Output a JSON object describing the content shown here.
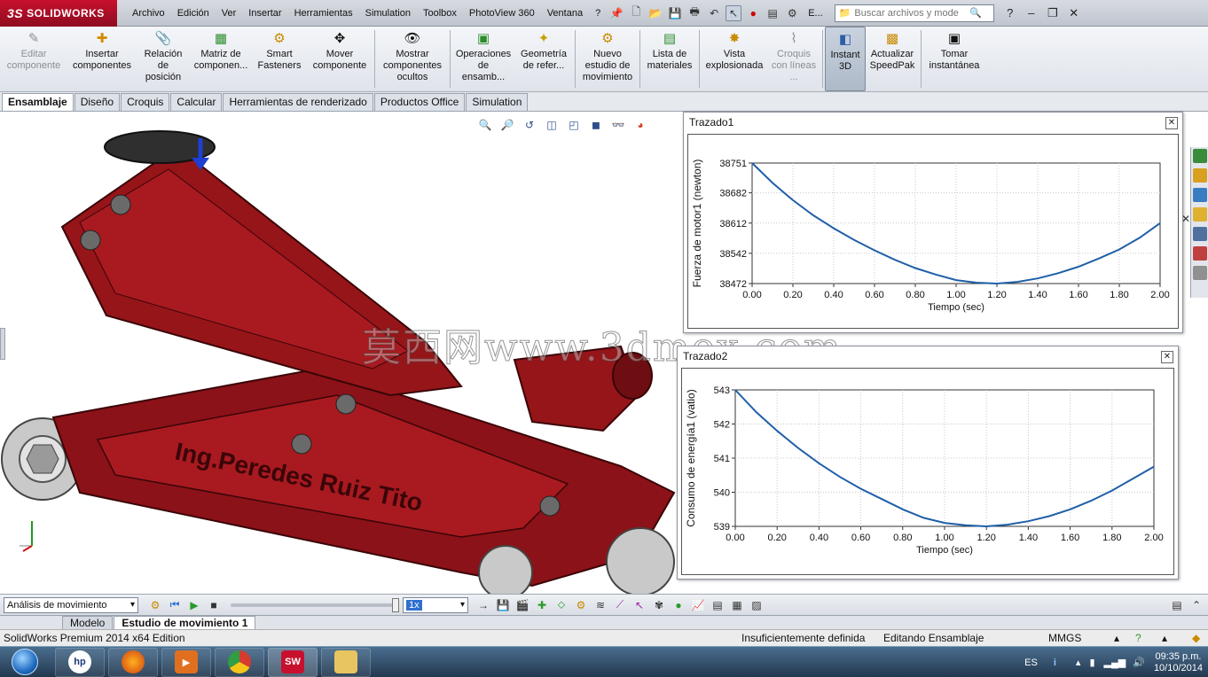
{
  "app": {
    "brand": "SOLIDWORKS",
    "brand_prefix": "3S"
  },
  "menu": {
    "items": [
      "Archivo",
      "Edición",
      "Ver",
      "Insertar",
      "Herramientas",
      "Simulation",
      "Toolbox",
      "PhotoView 360",
      "Ventana",
      "?"
    ],
    "overflow_label": "E...",
    "search_placeholder": "Buscar archivos y mode"
  },
  "commands": [
    {
      "label": "Editar componente",
      "icon": "edit-component-icon",
      "disabled": true
    },
    {
      "label": "Insertar componentes",
      "icon": "insert-components-icon",
      "disabled": false
    },
    {
      "label": "Relación de posición",
      "icon": "mate-icon",
      "disabled": false
    },
    {
      "label": "Matriz de componen...",
      "icon": "component-pattern-icon",
      "disabled": false
    },
    {
      "label": "Smart Fasteners",
      "icon": "smart-fasteners-icon",
      "disabled": false
    },
    {
      "label": "Mover componente",
      "icon": "move-component-icon",
      "disabled": false
    },
    {
      "label": "Mostrar componentes ocultos",
      "icon": "show-hidden-icon",
      "disabled": false
    },
    {
      "label": "Operaciones de ensamb...",
      "icon": "assembly-features-icon",
      "disabled": false
    },
    {
      "label": "Geometría de refer...",
      "icon": "reference-geometry-icon",
      "disabled": false
    },
    {
      "label": "Nuevo estudio de movimiento",
      "icon": "new-motion-study-icon",
      "disabled": false
    },
    {
      "label": "Lista de materiales",
      "icon": "bill-of-materials-icon",
      "disabled": false
    },
    {
      "label": "Vista explosionada",
      "icon": "exploded-view-icon",
      "disabled": false
    },
    {
      "label": "Croquis con líneas ...",
      "icon": "explode-line-sketch-icon",
      "disabled": true
    },
    {
      "label": "Instant 3D",
      "icon": "instant3d-icon",
      "disabled": false,
      "active": true
    },
    {
      "label": "Actualizar SpeedPak",
      "icon": "speedpak-icon",
      "disabled": false
    },
    {
      "label": "Tomar instantánea",
      "icon": "snapshot-icon",
      "disabled": false
    }
  ],
  "tabs": [
    "Ensamblaje",
    "Diseño",
    "Croquis",
    "Calcular",
    "Herramientas de renderizado",
    "Productos Office",
    "Simulation"
  ],
  "active_tab": 0,
  "model": {
    "engraving": "Ing.Peredes Ruiz Tito"
  },
  "watermark": "莫西网www.3dmox.com",
  "plots": [
    {
      "title": "Trazado1",
      "chart_data": {
        "type": "line",
        "xlabel": "Tiempo (sec)",
        "ylabel": "Fuerza de motor1 (newton)",
        "xlim": [
          0,
          2
        ],
        "ylim": [
          38472,
          38751
        ],
        "x_ticks": [
          "0.00",
          "0.20",
          "0.40",
          "0.60",
          "0.80",
          "1.00",
          "1.20",
          "1.40",
          "1.60",
          "1.80",
          "2.00"
        ],
        "y_ticks": [
          "38751",
          "38682",
          "38612",
          "38542",
          "38472"
        ],
        "grid": true,
        "series": [
          {
            "x": [
              0.0,
              0.1,
              0.2,
              0.3,
              0.4,
              0.5,
              0.6,
              0.7,
              0.8,
              0.9,
              1.0,
              1.1,
              1.2,
              1.3,
              1.4,
              1.5,
              1.6,
              1.7,
              1.8,
              1.9,
              2.0
            ],
            "y": [
              38751,
              38705,
              38665,
              38630,
              38600,
              38573,
              38549,
              38527,
              38508,
              38493,
              38480,
              38474,
              38472,
              38476,
              38484,
              38496,
              38511,
              38530,
              38551,
              38578,
              38612
            ],
            "color": "#1f5fa8"
          }
        ]
      }
    },
    {
      "title": "Trazado2",
      "chart_data": {
        "type": "line",
        "xlabel": "Tiempo (sec)",
        "ylabel": "Consumo de energía1 (vatio)",
        "xlim": [
          0,
          2
        ],
        "ylim": [
          539,
          543
        ],
        "x_ticks": [
          "0.00",
          "0.20",
          "0.40",
          "0.60",
          "0.80",
          "1.00",
          "1.20",
          "1.40",
          "1.60",
          "1.80",
          "2.00"
        ],
        "y_ticks": [
          "543",
          "542",
          "541",
          "540",
          "539"
        ],
        "grid": true,
        "series": [
          {
            "x": [
              0.0,
              0.1,
              0.2,
              0.3,
              0.4,
              0.5,
              0.6,
              0.7,
              0.8,
              0.9,
              1.0,
              1.1,
              1.2,
              1.3,
              1.4,
              1.5,
              1.6,
              1.7,
              1.8,
              1.9,
              2.0
            ],
            "y": [
              543.0,
              542.35,
              541.8,
              541.3,
              540.85,
              540.45,
              540.1,
              539.8,
              539.5,
              539.25,
              539.1,
              539.03,
              539.0,
              539.05,
              539.15,
              539.3,
              539.5,
              539.75,
              540.05,
              540.4,
              540.75
            ],
            "color": "#1f5fa8"
          }
        ]
      }
    }
  ],
  "motion": {
    "study_type": "Análisis de movimiento",
    "playback_speed": "1x"
  },
  "bottom_tabs": [
    "Modelo",
    "Estudio de movimiento 1"
  ],
  "active_bottom_tab": 1,
  "status": {
    "edition": "SolidWorks Premium 2014 x64 Edition",
    "definition": "Insuficientemente definida",
    "mode": "Editando Ensamblaje",
    "units": "MMGS"
  },
  "taskbar": {
    "apps": [
      "windows-explorer-hp",
      "firefox",
      "media-player",
      "chrome",
      "solidworks",
      "file-explorer"
    ],
    "language": "ES",
    "time": "09:35 p.m.",
    "date": "10/10/2014"
  }
}
